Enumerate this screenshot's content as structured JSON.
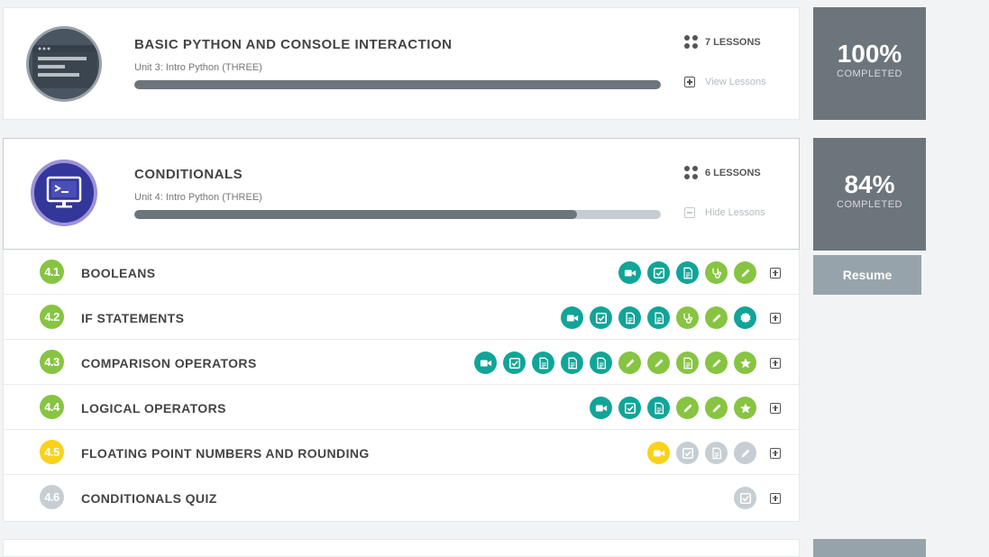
{
  "units": [
    {
      "title": "BASIC PYTHON AND CONSOLE INTERACTION",
      "subtitle": "Unit 3: Intro Python (THREE)",
      "progress": 1.0,
      "lessons_count": "7 LESSONS",
      "toggle_label": "View Lessons",
      "percent": "100%",
      "completed_label": "COMPLETED",
      "image_icon": "browser-window-icon"
    },
    {
      "title": "CONDITIONALS",
      "subtitle": "Unit 4: Intro Python (THREE)",
      "progress": 0.84,
      "lessons_count": "6 LESSONS",
      "toggle_label": "Hide Lessons",
      "percent": "84%",
      "completed_label": "COMPLETED",
      "image_icon": "terminal-monitor-icon"
    }
  ],
  "resume_label": "Resume",
  "colors": {
    "teal": "#10a598",
    "green": "#87c442",
    "yellow": "#f8d21b",
    "grey": "#c6ced3",
    "dark_grey": "#6d757c"
  },
  "lessons": [
    {
      "number": "4.1",
      "title": "BOOLEANS",
      "status": "green",
      "activities": [
        {
          "icon": "video-icon",
          "color": "teal"
        },
        {
          "icon": "checkbox-icon",
          "color": "teal"
        },
        {
          "icon": "document-icon",
          "color": "teal"
        },
        {
          "icon": "stethoscope-icon",
          "color": "green"
        },
        {
          "icon": "pencil-icon",
          "color": "green"
        }
      ]
    },
    {
      "number": "4.2",
      "title": "IF STATEMENTS",
      "status": "green",
      "activities": [
        {
          "icon": "video-icon",
          "color": "teal"
        },
        {
          "icon": "checkbox-icon",
          "color": "teal"
        },
        {
          "icon": "document-icon",
          "color": "teal"
        },
        {
          "icon": "document-icon",
          "color": "teal"
        },
        {
          "icon": "stethoscope-icon",
          "color": "green"
        },
        {
          "icon": "pencil-icon",
          "color": "green"
        },
        {
          "icon": "badge-icon",
          "color": "teal"
        }
      ]
    },
    {
      "number": "4.3",
      "title": "COMPARISON OPERATORS",
      "status": "green",
      "activities": [
        {
          "icon": "video-icon",
          "color": "teal"
        },
        {
          "icon": "checkbox-icon",
          "color": "teal"
        },
        {
          "icon": "document-icon",
          "color": "teal"
        },
        {
          "icon": "document-icon",
          "color": "teal"
        },
        {
          "icon": "document-icon",
          "color": "teal"
        },
        {
          "icon": "pencil-icon",
          "color": "green"
        },
        {
          "icon": "pencil-icon",
          "color": "green"
        },
        {
          "icon": "document-icon",
          "color": "green"
        },
        {
          "icon": "pencil-icon",
          "color": "green"
        },
        {
          "icon": "star-icon",
          "color": "green"
        }
      ]
    },
    {
      "number": "4.4",
      "title": "LOGICAL OPERATORS",
      "status": "green",
      "activities": [
        {
          "icon": "video-icon",
          "color": "teal"
        },
        {
          "icon": "checkbox-icon",
          "color": "teal"
        },
        {
          "icon": "document-icon",
          "color": "teal"
        },
        {
          "icon": "pencil-icon",
          "color": "green"
        },
        {
          "icon": "pencil-icon",
          "color": "green"
        },
        {
          "icon": "star-icon",
          "color": "green"
        }
      ]
    },
    {
      "number": "4.5",
      "title": "FLOATING POINT NUMBERS AND ROUNDING",
      "status": "yellow",
      "activities": [
        {
          "icon": "video-icon",
          "color": "yellow"
        },
        {
          "icon": "checkbox-icon",
          "color": "grey"
        },
        {
          "icon": "document-icon",
          "color": "grey"
        },
        {
          "icon": "pencil-icon",
          "color": "grey"
        }
      ]
    },
    {
      "number": "4.6",
      "title": "CONDITIONALS QUIZ",
      "status": "grey",
      "activities": [
        {
          "icon": "checkbox-icon",
          "color": "grey"
        }
      ]
    }
  ]
}
